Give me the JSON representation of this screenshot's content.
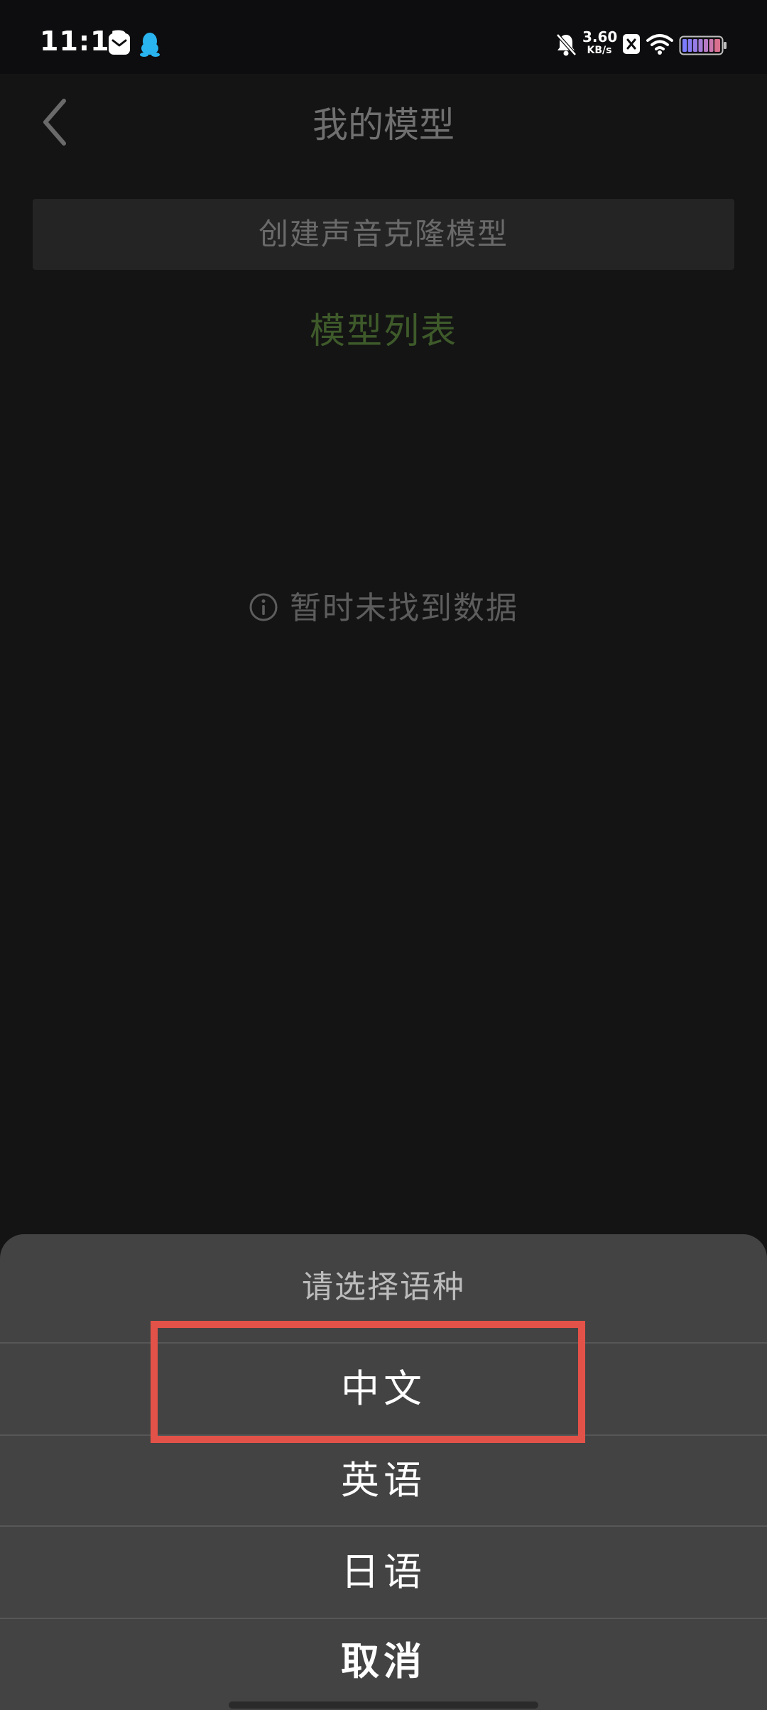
{
  "status_bar": {
    "time": "11:13",
    "net_speed_value": "3.60",
    "net_speed_unit": "KB/s",
    "icons": [
      "mail-icon",
      "qq-penguin-icon",
      "bell-off-icon",
      "x-app-icon",
      "wifi-icon",
      "battery-icon"
    ]
  },
  "header": {
    "title": "我的模型",
    "back_icon": "chevron-left-icon"
  },
  "main": {
    "create_button_label": "创建声音克隆模型",
    "list_title": "模型列表",
    "empty_text": "暂时未找到数据",
    "empty_icon": "info-icon"
  },
  "sheet": {
    "title": "请选择语种",
    "options": [
      {
        "label": "中文"
      },
      {
        "label": "英语"
      },
      {
        "label": "日语"
      }
    ],
    "cancel_label": "取消"
  },
  "colors": {
    "background": "#141414",
    "sheet_background": "#434343",
    "list_title": "#3e5a2a",
    "highlight_border": "#e35248",
    "qq_icon": "#29b4f0"
  }
}
